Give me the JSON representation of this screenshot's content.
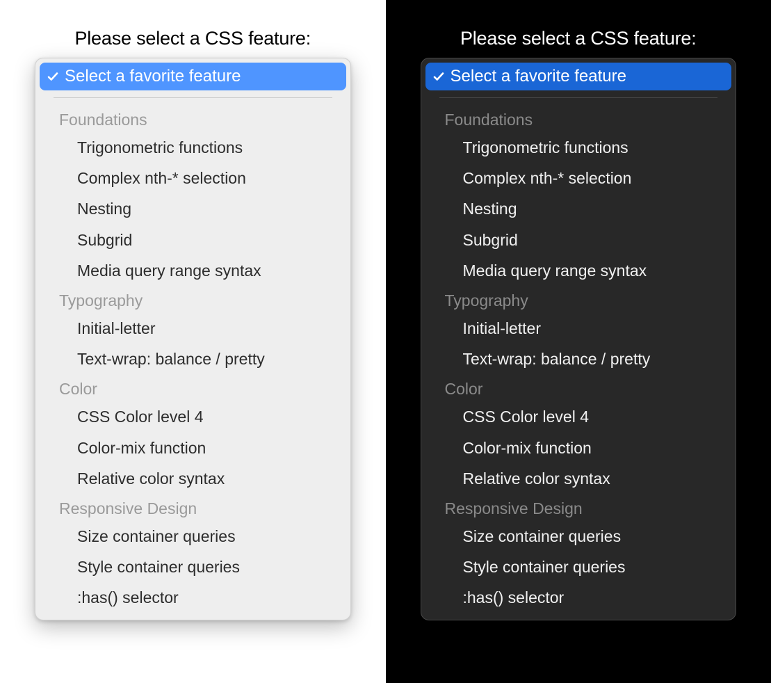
{
  "prompt": "Please select a CSS feature:",
  "selected_label": "Select a favorite feature",
  "colors": {
    "light_accent": "#4f95ff",
    "dark_accent": "#1a66d6"
  },
  "groups": [
    {
      "label": "Foundations",
      "options": [
        "Trigonometric functions",
        "Complex nth-* selection",
        "Nesting",
        "Subgrid",
        "Media query range syntax"
      ]
    },
    {
      "label": "Typography",
      "options": [
        "Initial-letter",
        "Text-wrap: balance / pretty"
      ]
    },
    {
      "label": "Color",
      "options": [
        "CSS Color level 4",
        "Color-mix function",
        "Relative color syntax"
      ]
    },
    {
      "label": "Responsive Design",
      "options": [
        "Size container queries",
        "Style container queries",
        ":has() selector"
      ]
    }
  ]
}
